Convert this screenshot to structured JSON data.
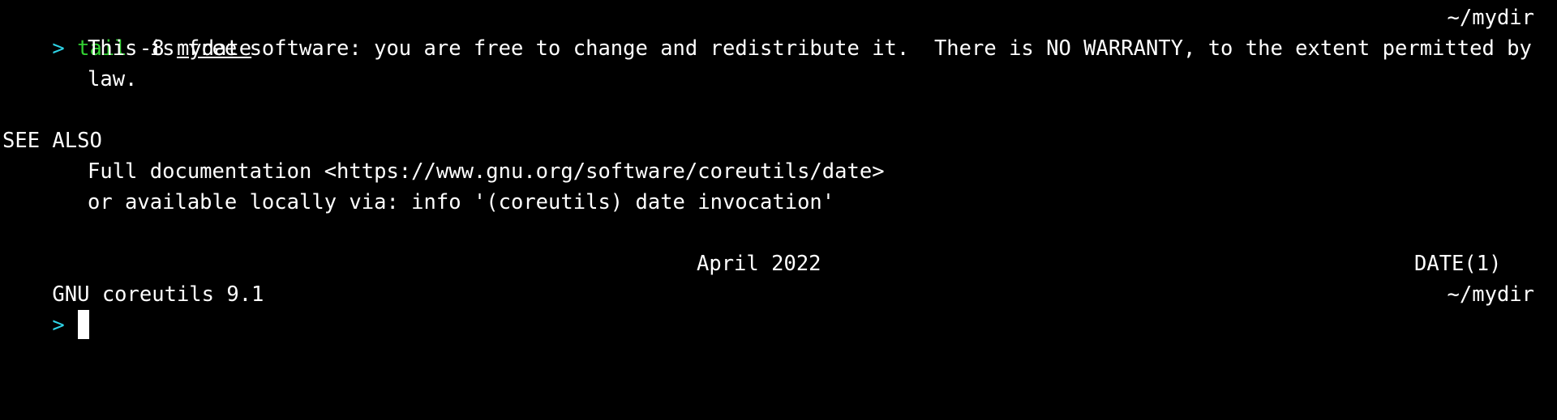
{
  "colors": {
    "background": "#000000",
    "foreground": "#ffffff",
    "prompt": "#2ed3e6",
    "command": "#32d032"
  },
  "command_line": {
    "prompt": ">",
    "command": "tail",
    "args": "-8",
    "file": "mydate",
    "cwd": "~/mydir"
  },
  "output": {
    "copyright_line1": "This is free software: you are free to change and redistribute it.  There is NO WARRANTY, to the extent permitted by",
    "copyright_line2": "law.",
    "see_also_heading": "SEE ALSO",
    "doc_line": "Full documentation <https://www.gnu.org/software/coreutils/date>",
    "info_line": "or available locally via: info '(coreutils) date invocation'",
    "footer_left": "GNU coreutils 9.1",
    "footer_center": "April 2022",
    "footer_right": "DATE(1)"
  },
  "current_prompt": {
    "prompt": ">",
    "cwd": "~/mydir"
  }
}
